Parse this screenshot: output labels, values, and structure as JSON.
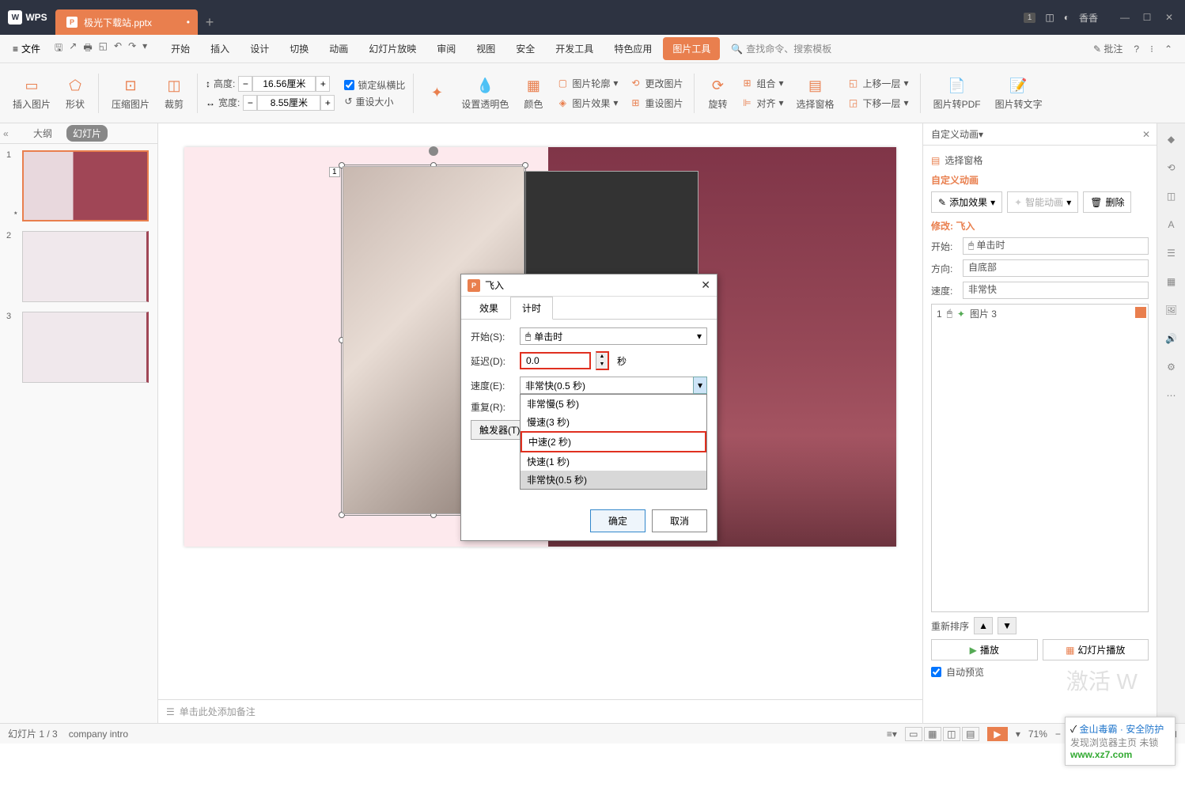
{
  "titlebar": {
    "app": "WPS",
    "tab_name": "极光下载站.pptx",
    "user": "香香",
    "badge": "1"
  },
  "menu": {
    "file": "文件",
    "tabs": [
      "开始",
      "插入",
      "设计",
      "切换",
      "动画",
      "幻灯片放映",
      "审阅",
      "视图",
      "安全",
      "开发工具",
      "特色应用"
    ],
    "active_tab": "图片工具",
    "search": "查找命令、搜索模板",
    "review": "批注"
  },
  "ribbon": {
    "insert_pic": "插入图片",
    "shape": "形状",
    "compress": "压缩图片",
    "crop": "裁剪",
    "height_label": "高度:",
    "height_value": "16.56厘米",
    "width_label": "宽度:",
    "width_value": "8.55厘米",
    "lock": "锁定纵横比",
    "reset_size": "重设大小",
    "snap": "✦",
    "transparency": "设置透明色",
    "color": "颜色",
    "outline": "图片轮廓",
    "effect": "图片效果",
    "change": "更改图片",
    "reset_pic": "重设图片",
    "rotate": "旋转",
    "group": "组合",
    "align": "对齐",
    "sel_pane": "选择窗格",
    "up": "上移一层",
    "down": "下移一层",
    "to_pdf": "图片转PDF",
    "to_text": "图片转文字"
  },
  "slidepanel": {
    "outline": "大纲",
    "slides": "幻灯片",
    "thumbs": [
      1,
      2,
      3
    ]
  },
  "notes": "单击此处添加备注",
  "right": {
    "title": "自定义动画",
    "sel_pane": "选择窗格",
    "section": "自定义动画",
    "add_effect": "添加效果",
    "smart": "智能动画",
    "delete": "删除",
    "modify": "修改: 飞入",
    "start_label": "开始:",
    "start_value": "单击时",
    "dir_label": "方向:",
    "dir_value": "自底部",
    "speed_label": "速度:",
    "speed_value": "非常快",
    "anim_item": "图片 3",
    "anim_idx": "1",
    "reorder": "重新排序",
    "play": "播放",
    "slideshow": "幻灯片播放",
    "autoprev": "自动预览"
  },
  "dialog": {
    "title": "飞入",
    "tab_effect": "效果",
    "tab_timing": "计时",
    "start_label": "开始(S):",
    "start_value": "单击时",
    "delay_label": "延迟(D):",
    "delay_value": "0.0",
    "delay_suffix": "秒",
    "speed_label": "速度(E):",
    "speed_value": "非常快(0.5 秒)",
    "repeat_label": "重复(R):",
    "trigger": "触发器(T)",
    "options": [
      "非常慢(5 秒)",
      "慢速(3 秒)",
      "中速(2 秒)",
      "快速(1 秒)",
      "非常快(0.5 秒)"
    ],
    "ok": "确定",
    "cancel": "取消"
  },
  "status": {
    "slide": "幻灯片 1 / 3",
    "theme": "company intro",
    "zoom": "71%"
  },
  "popup": {
    "line1": "金山毒霸 · 安全防护",
    "line2": "发现浏览器主页 未锁",
    "url": "www.xz7.com"
  },
  "watermark": "激活 W"
}
